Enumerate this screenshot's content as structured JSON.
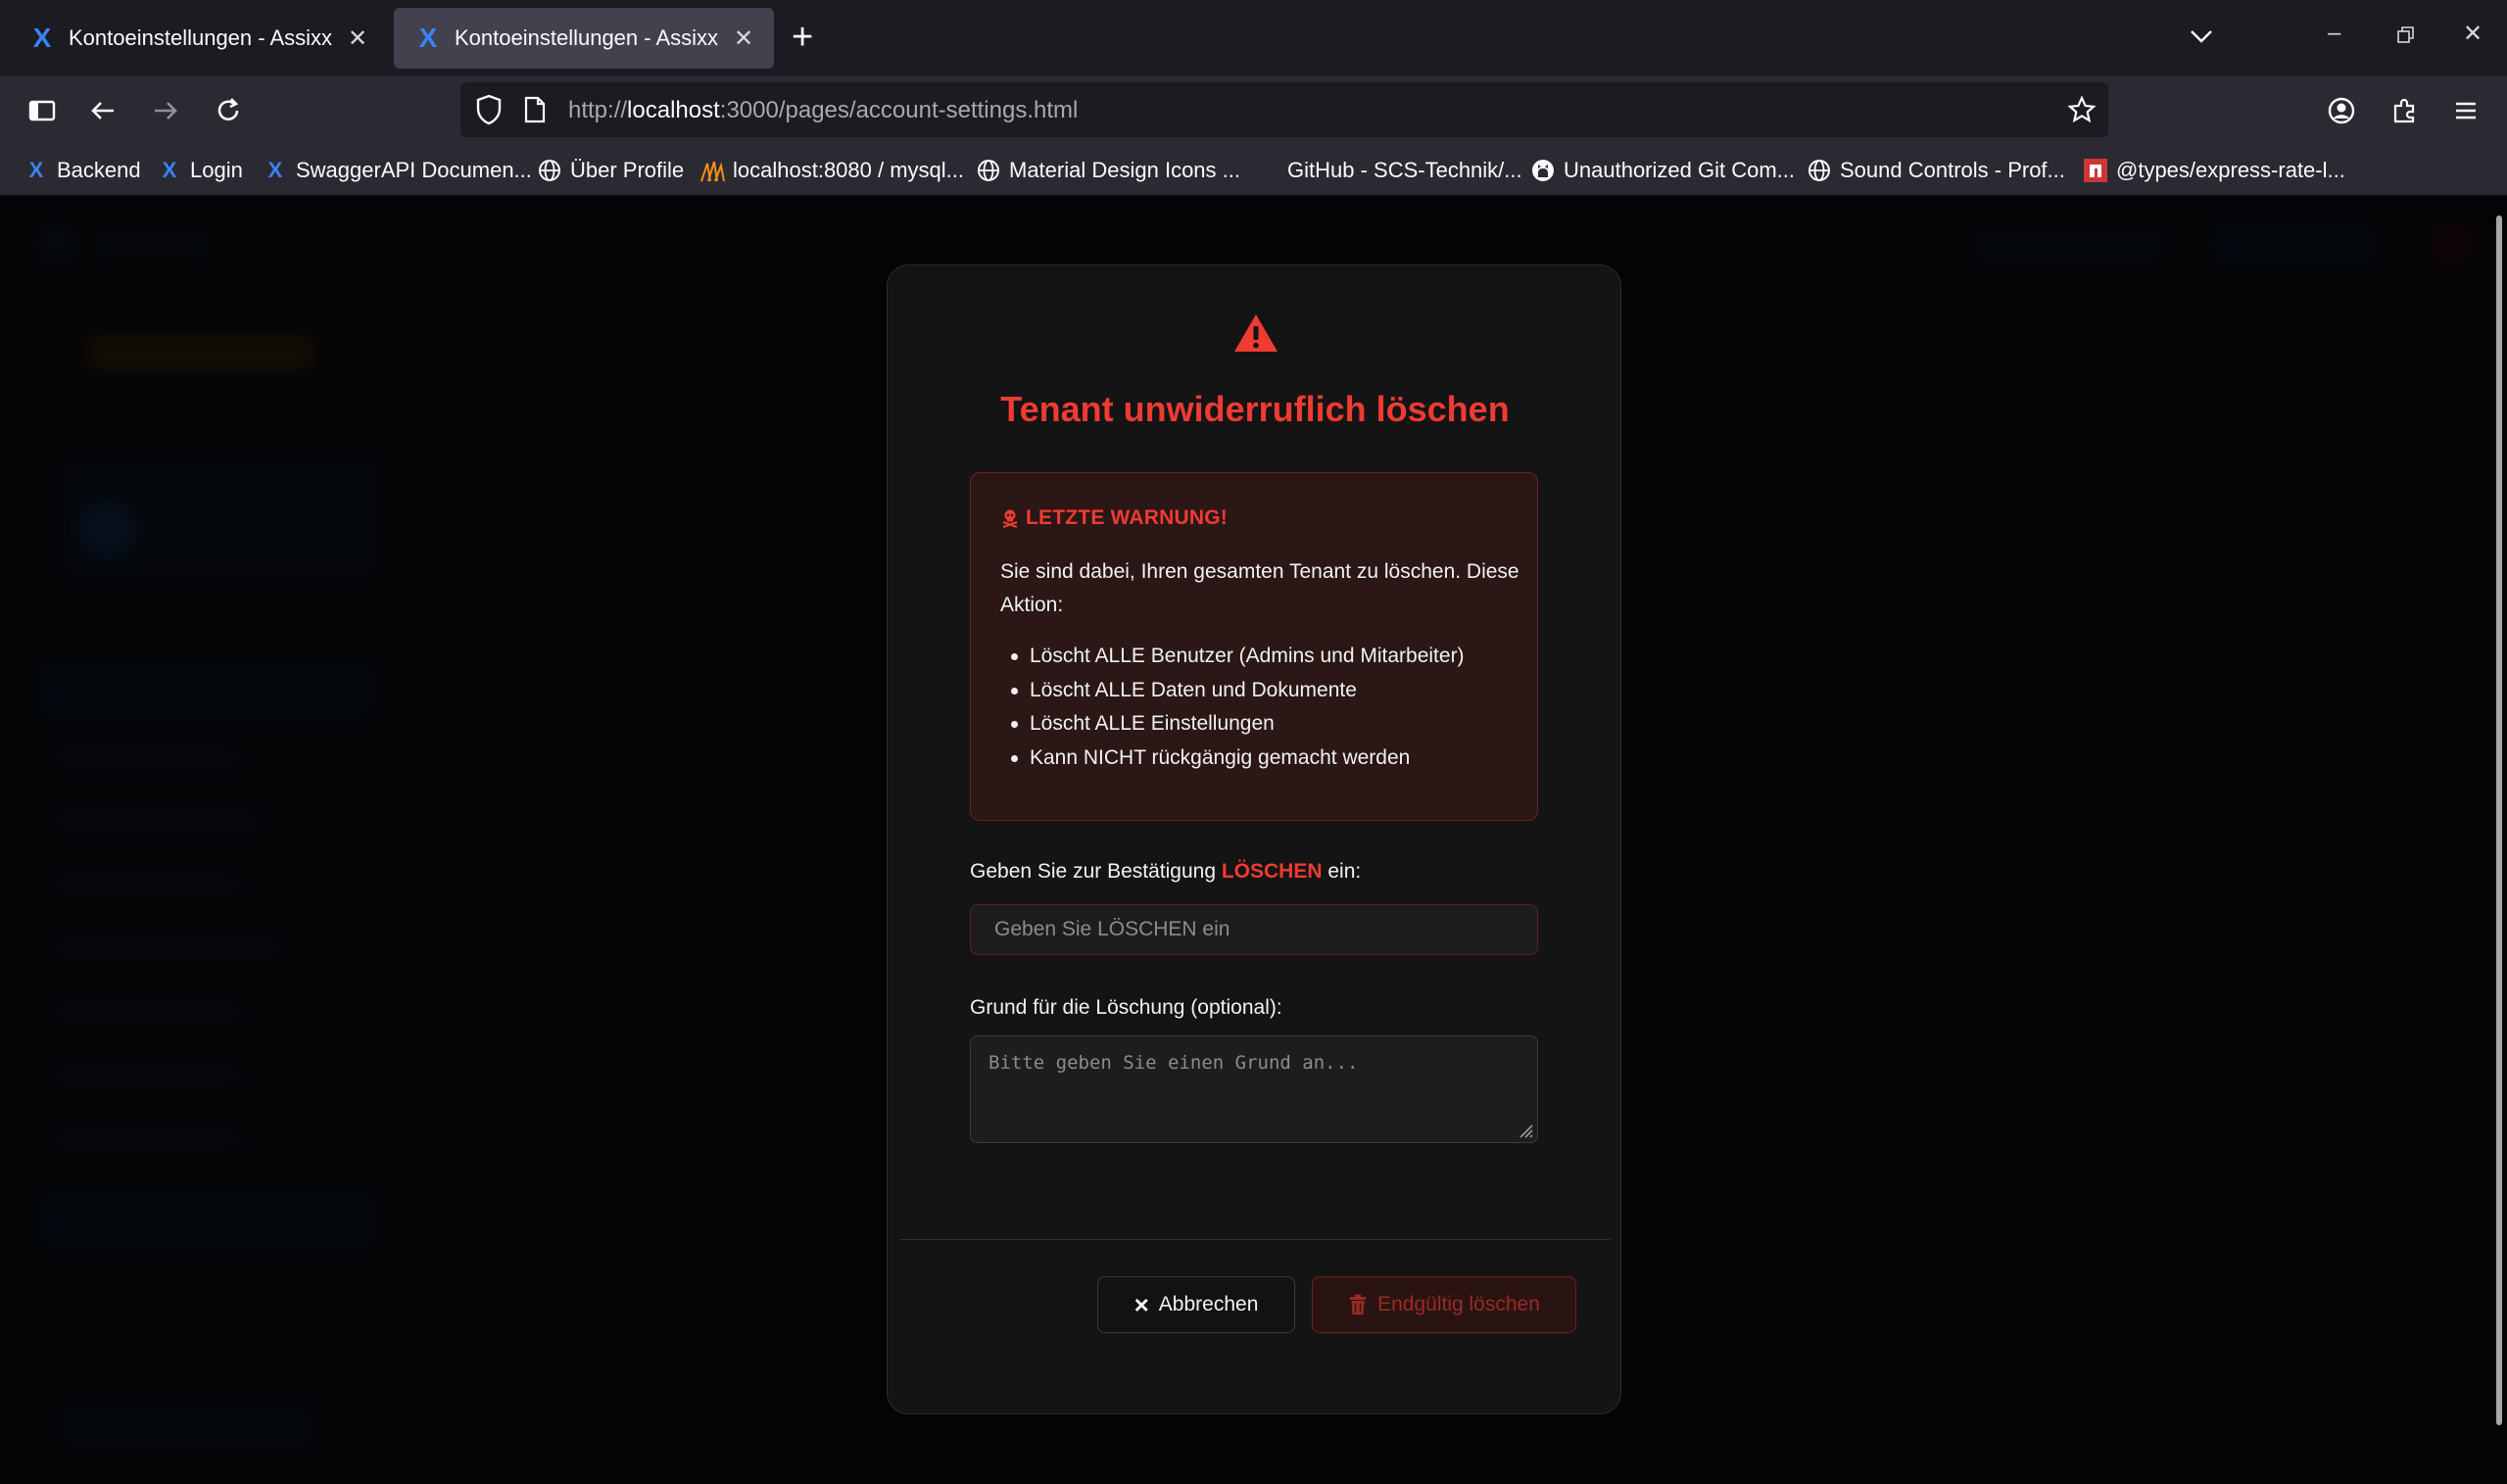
{
  "browser": {
    "tabs": [
      {
        "title": "Kontoeinstellungen - Assixx",
        "active": false
      },
      {
        "title": "Kontoeinstellungen - Assixx",
        "active": true
      }
    ],
    "url": {
      "scheme": "http://",
      "host": "localhost",
      "rest": ":3000/pages/account-settings.html"
    },
    "bookmarks": [
      {
        "label": "Backend",
        "icon": "assixx-x-icon"
      },
      {
        "label": "Login",
        "icon": "assixx-x-icon"
      },
      {
        "label": "SwaggerAPI Documen...",
        "icon": "assixx-x-icon"
      },
      {
        "label": "Über Profile",
        "icon": "globe-icon"
      },
      {
        "label": "localhost:8080 / mysql...",
        "icon": "phpmyadmin-icon"
      },
      {
        "label": "Material Design Icons ...",
        "icon": "globe-icon"
      },
      {
        "label": "GitHub - SCS-Technik/...",
        "icon": "none"
      },
      {
        "label": "Unauthorized Git Com...",
        "icon": "github-icon"
      },
      {
        "label": "Sound Controls - Prof...",
        "icon": "globe-icon"
      },
      {
        "label": "@types/express-rate-l...",
        "icon": "npm-icon"
      }
    ]
  },
  "modal": {
    "title": "Tenant unwiderruflich löschen",
    "warning": {
      "heading": "LETZTE WARNUNG!",
      "text": "Sie sind dabei, Ihren gesamten Tenant zu löschen. Diese Aktion:",
      "items": [
        "Löscht ALLE Benutzer (Admins und Mitarbeiter)",
        "Löscht ALLE Daten und Dokumente",
        "Löscht ALLE Einstellungen",
        "Kann NICHT rückgängig gemacht werden"
      ]
    },
    "confirm": {
      "label_before": "Geben Sie zur Bestätigung ",
      "keyword": "LÖSCHEN",
      "label_after": " ein:",
      "placeholder": "Geben Sie LÖSCHEN ein",
      "value": ""
    },
    "reason": {
      "label": "Grund für die Löschung (optional):",
      "placeholder": "Bitte geben Sie einen Grund an...",
      "value": ""
    },
    "buttons": {
      "cancel": "Abbrechen",
      "delete": "Endgültig löschen"
    }
  },
  "colors": {
    "danger": "#ef3b32",
    "modal_bg": "#141414",
    "warning_bg": "#2a1716"
  }
}
